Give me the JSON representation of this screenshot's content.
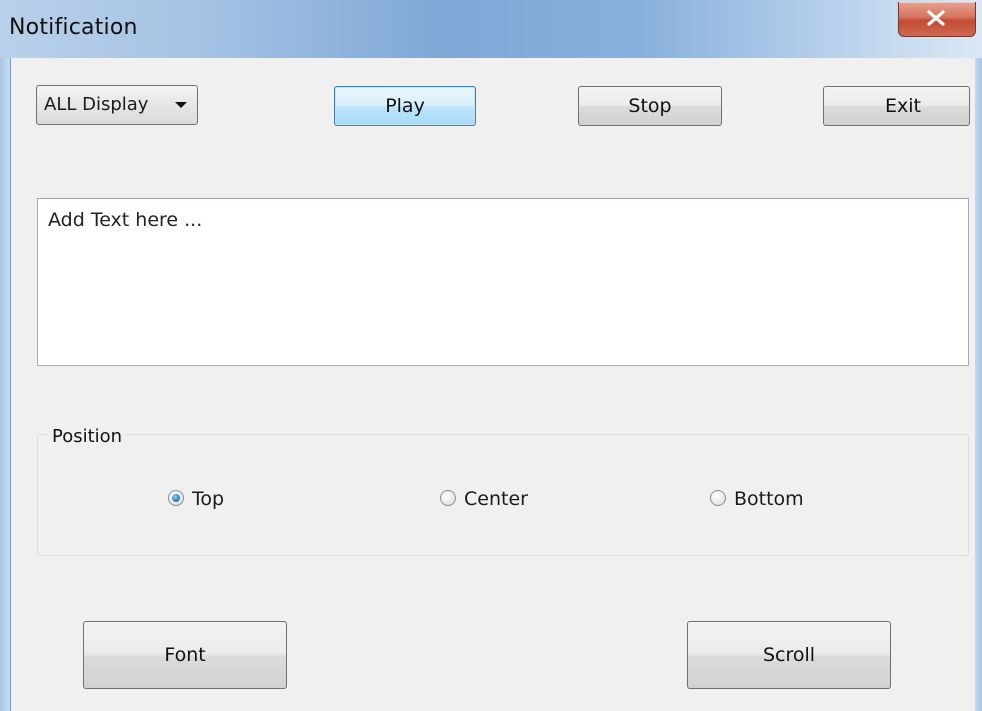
{
  "window": {
    "title": "Notification"
  },
  "toolbar": {
    "display_select": "ALL Display",
    "play_label": "Play",
    "stop_label": "Stop",
    "exit_label": "Exit"
  },
  "message": {
    "placeholder": "Add Text here ..."
  },
  "position": {
    "legend": "Position",
    "options": [
      "Top",
      "Center",
      "Bottom"
    ],
    "selected": "Top"
  },
  "footer": {
    "font_label": "Font",
    "scroll_label": "Scroll"
  }
}
